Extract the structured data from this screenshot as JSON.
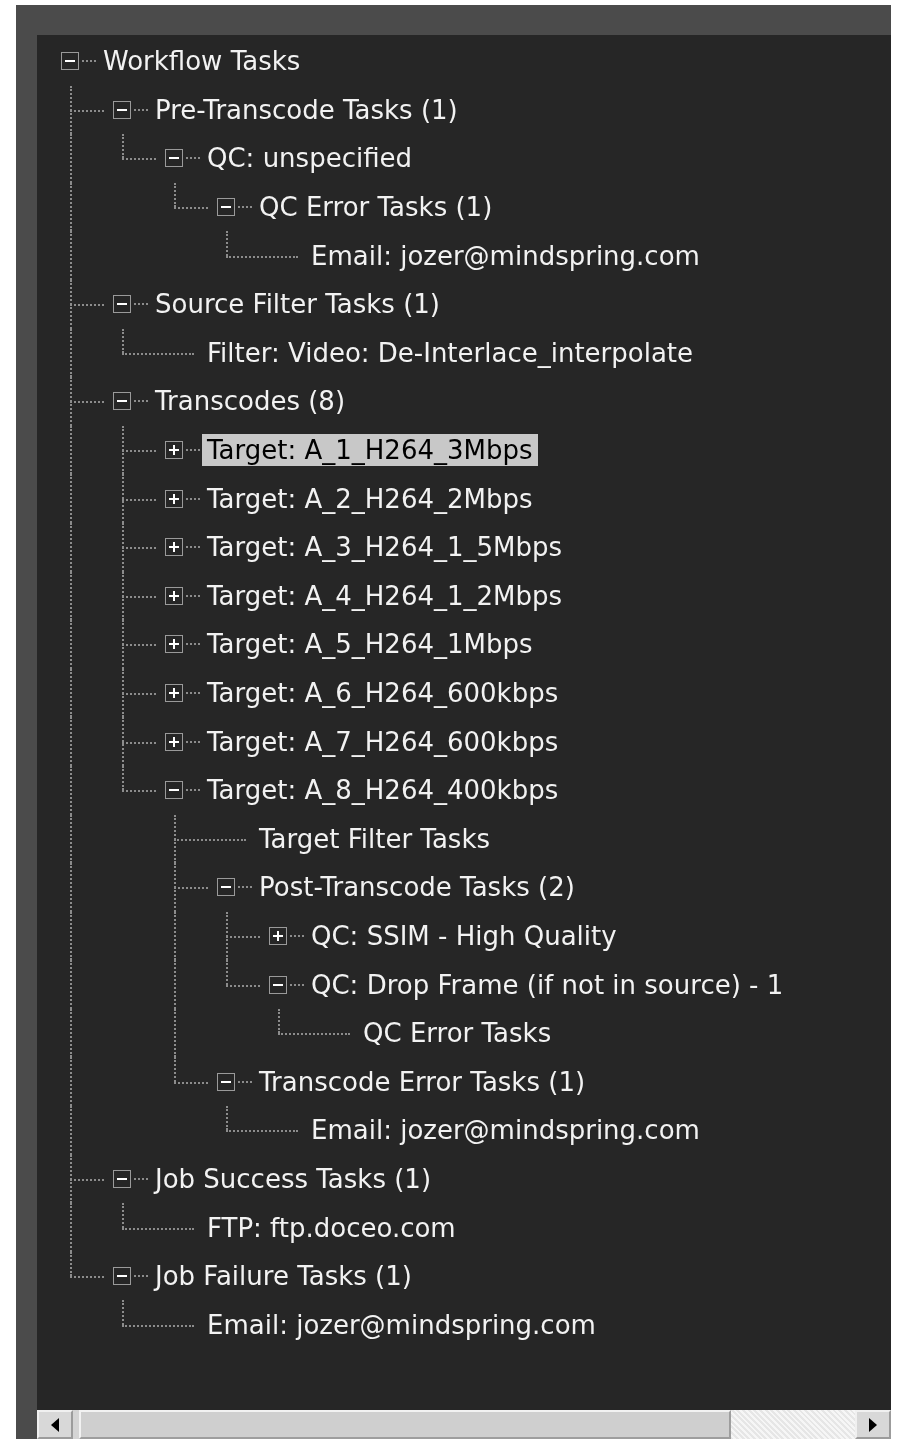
{
  "tree": [
    {
      "label": "Workflow Tasks",
      "expanded": true,
      "selected": false,
      "children": [
        {
          "label": "Pre-Transcode Tasks (1)",
          "expanded": true,
          "selected": false,
          "children": [
            {
              "label": "QC: unspecified",
              "expanded": true,
              "selected": false,
              "children": [
                {
                  "label": "QC Error Tasks (1)",
                  "expanded": true,
                  "selected": false,
                  "children": [
                    {
                      "label": "Email: jozer@mindspring.com",
                      "selected": false
                    }
                  ]
                }
              ]
            }
          ]
        },
        {
          "label": "Source Filter Tasks (1)",
          "expanded": true,
          "selected": false,
          "children": [
            {
              "label": "Filter: Video: De-Interlace_interpolate",
              "selected": false
            }
          ]
        },
        {
          "label": "Transcodes (8)",
          "expanded": true,
          "selected": false,
          "children": [
            {
              "label": "Target: A_1_H264_3Mbps",
              "expanded": false,
              "selected": true
            },
            {
              "label": "Target: A_2_H264_2Mbps",
              "expanded": false,
              "selected": false
            },
            {
              "label": "Target: A_3_H264_1_5Mbps",
              "expanded": false,
              "selected": false
            },
            {
              "label": "Target: A_4_H264_1_2Mbps",
              "expanded": false,
              "selected": false
            },
            {
              "label": "Target: A_5_H264_1Mbps",
              "expanded": false,
              "selected": false
            },
            {
              "label": "Target: A_6_H264_600kbps",
              "expanded": false,
              "selected": false
            },
            {
              "label": "Target: A_7_H264_600kbps",
              "expanded": false,
              "selected": false
            },
            {
              "label": "Target: A_8_H264_400kbps",
              "expanded": true,
              "selected": false,
              "children": [
                {
                  "label": "Target Filter Tasks",
                  "selected": false
                },
                {
                  "label": "Post-Transcode Tasks (2)",
                  "expanded": true,
                  "selected": false,
                  "children": [
                    {
                      "label": "QC: SSIM - High Quality",
                      "expanded": false,
                      "selected": false
                    },
                    {
                      "label": "QC: Drop Frame (if not in source) - 1",
                      "expanded": true,
                      "selected": false,
                      "children": [
                        {
                          "label": "QC Error Tasks",
                          "selected": false
                        }
                      ]
                    }
                  ]
                },
                {
                  "label": "Transcode Error Tasks (1)",
                  "expanded": true,
                  "selected": false,
                  "children": [
                    {
                      "label": "Email: jozer@mindspring.com",
                      "selected": false
                    }
                  ]
                }
              ]
            }
          ]
        },
        {
          "label": "Job Success Tasks (1)",
          "expanded": true,
          "selected": false,
          "children": [
            {
              "label": "FTP: ftp.doceo.com",
              "selected": false
            }
          ]
        },
        {
          "label": "Job Failure Tasks (1)",
          "expanded": true,
          "selected": false,
          "children": [
            {
              "label": "Email: jozer@mindspring.com",
              "selected": false
            }
          ]
        }
      ]
    }
  ]
}
